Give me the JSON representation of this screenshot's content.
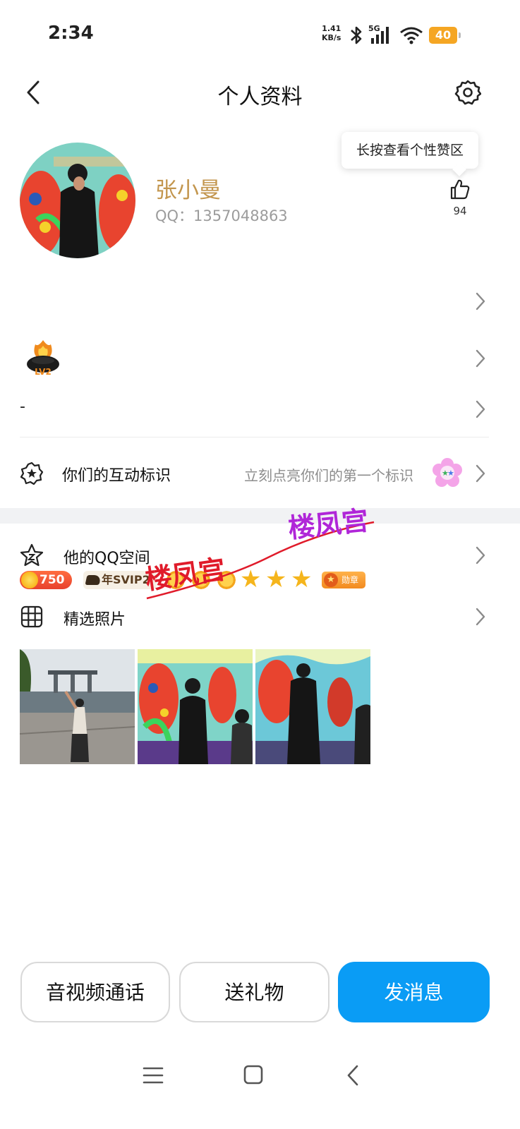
{
  "status_bar": {
    "time": "2:34",
    "net_speed_value": "1.41",
    "net_speed_unit": "KB/s",
    "network": "5G",
    "battery": "40",
    "battery_color": "#f5a623"
  },
  "header": {
    "title": "个人资料",
    "back_icon": "chevron-left-icon",
    "settings_icon": "gear-icon"
  },
  "profile": {
    "nickname": "张小曼",
    "qq_number": "QQ：1357048863",
    "tooltip": "长按查看个性赞区",
    "like_count": "94",
    "nickname_color": "#c3964e"
  },
  "badges": {
    "coin_value": "750",
    "svip_label": "年SVIP2",
    "sun_count": 3,
    "star_count": 3,
    "medal_label": "勋章"
  },
  "level": {
    "label": "LV2"
  },
  "signature": {
    "text": "-"
  },
  "interaction": {
    "label": "你们的互动标识",
    "hint": "立刻点亮你们的第一个标识"
  },
  "list": {
    "qzone_label": "他的QQ空间",
    "photos_label": "精选照片"
  },
  "watermark": {
    "text_a": "楼凤宫",
    "text_b": "楼凤宫"
  },
  "actions": {
    "call_label": "音视频通话",
    "gift_label": "送礼物",
    "message_label": "发消息",
    "primary_color": "#0a9cf5"
  }
}
